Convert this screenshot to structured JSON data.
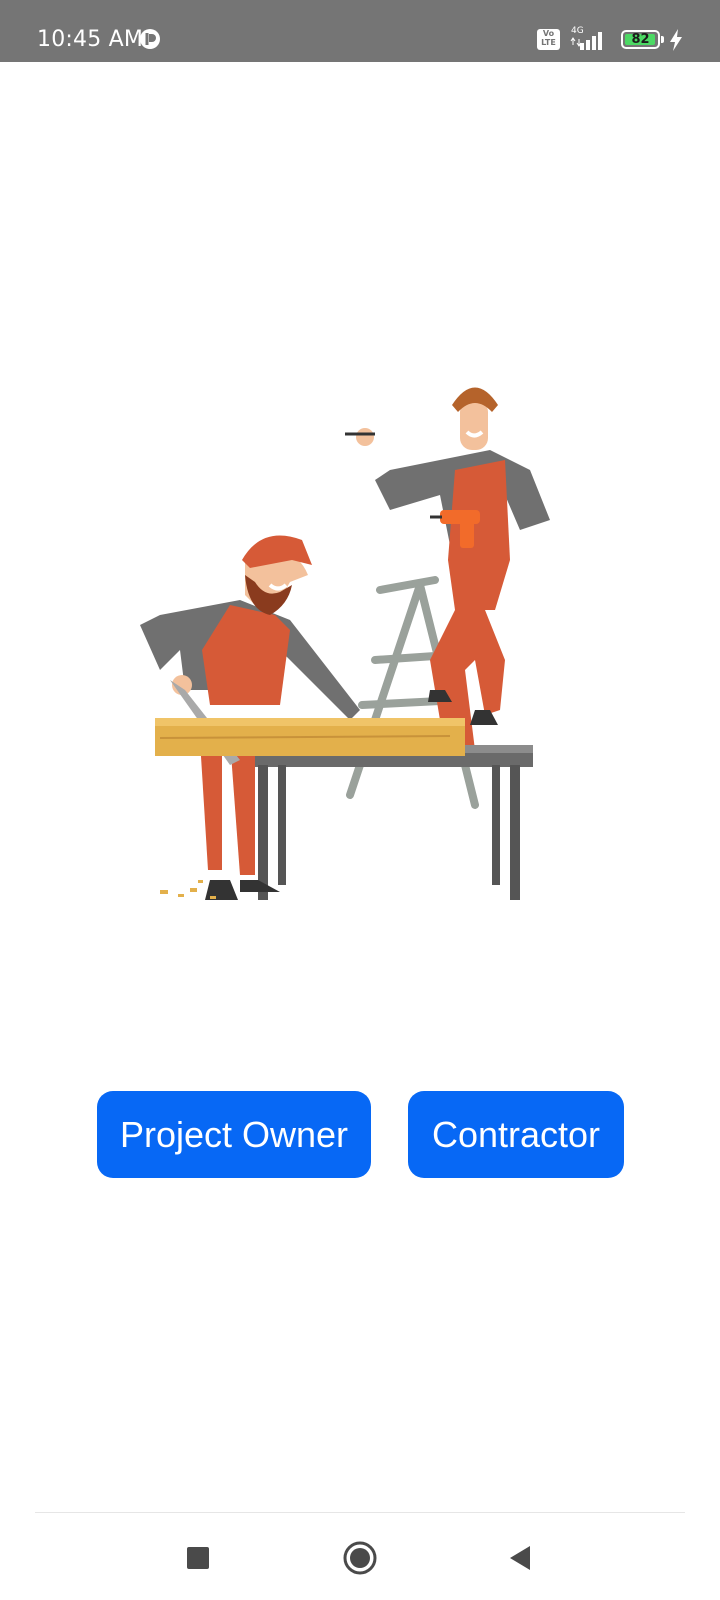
{
  "status_bar": {
    "time": "10:45 AM",
    "network_badge": [
      "Vo",
      "LTE"
    ],
    "network_type": "4G",
    "battery_level": "82",
    "icons": [
      "app-notification-icon",
      "volte-icon",
      "signal-icon",
      "battery-icon",
      "charging-icon"
    ]
  },
  "main": {
    "illustration": "carpenters-workshop-illustration",
    "buttons": {
      "project_owner": "Project Owner",
      "contractor": "Contractor"
    }
  },
  "nav_bar": {
    "icons": [
      "recents-icon",
      "home-icon",
      "back-icon"
    ]
  },
  "colors": {
    "status_bar": "#757575",
    "button": "#0768f5",
    "button_text": "#ffffff",
    "background": "#ffffff"
  }
}
